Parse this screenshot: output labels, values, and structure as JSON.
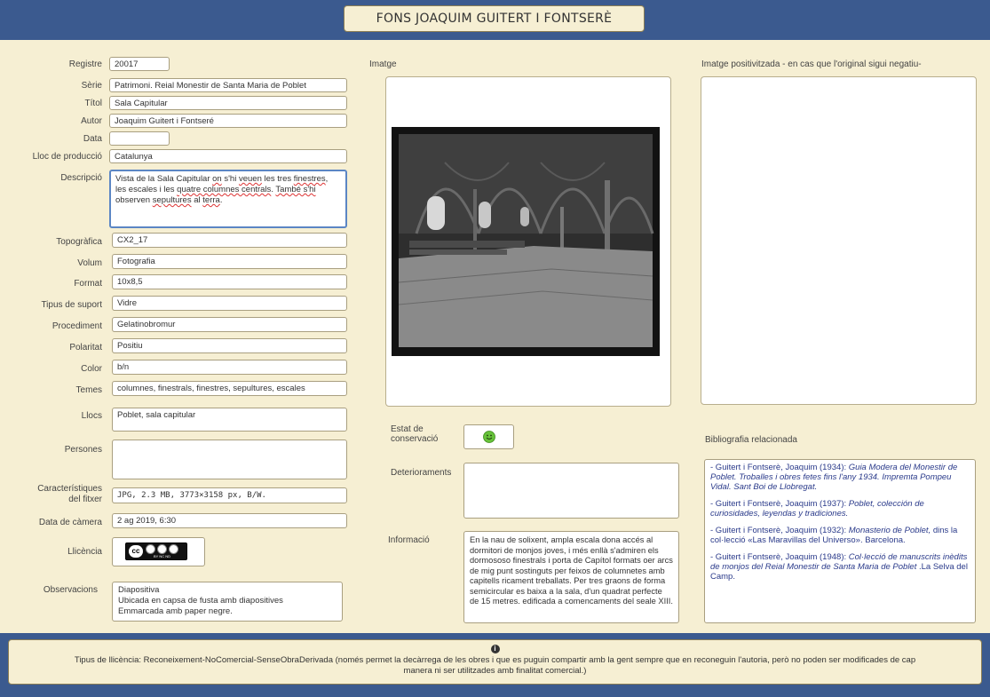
{
  "header": {
    "title": "FONS JOAQUIM GUITERT I FONTSERÈ"
  },
  "fields": {
    "registre": {
      "label": "Registre",
      "value": "20017"
    },
    "serie": {
      "label": "Sèrie",
      "value": "Patrimoni. Reial Monestir de Santa Maria de Poblet"
    },
    "titol": {
      "label": "Títol",
      "value": "Sala Capitular"
    },
    "autor": {
      "label": "Autor",
      "value": "Joaquim Guitert i Fontseré"
    },
    "data": {
      "label": "Data",
      "value": ""
    },
    "lloc": {
      "label": "Lloc de producció",
      "value": "Catalunya"
    },
    "descripcio": {
      "label": "Descripció",
      "parts": [
        "Vista de la Sala Capitular ",
        "on",
        " s'hi ",
        "veuen",
        " les tres ",
        "finestres",
        ", les escales i les ",
        "quatre columnes centrals",
        ". ",
        "També s'hi",
        " observen ",
        "sepultures",
        " al ",
        "terra",
        "."
      ]
    },
    "topografica": {
      "label": "Topogràfica",
      "value": "CX2_17"
    },
    "volum": {
      "label": "Volum",
      "value": "Fotografia"
    },
    "format": {
      "label": "Format",
      "value": "10x8,5"
    },
    "suport": {
      "label": "Tipus de suport",
      "value": "Vidre"
    },
    "procediment": {
      "label": "Procediment",
      "value": "Gelatinobromur"
    },
    "polaritat": {
      "label": "Polaritat",
      "value": "Positiu"
    },
    "color": {
      "label": "Color",
      "value": "b/n"
    },
    "temes": {
      "label": "Temes",
      "value": "columnes, finestrals, finestres, sepultures, escales"
    },
    "llocs": {
      "label": "Llocs",
      "value": "Poblet, sala capitular"
    },
    "persones": {
      "label": "Persones",
      "value": ""
    },
    "fitxer": {
      "label_line1": "Característiques",
      "label_line2": "del fitxer",
      "value": "JPG, 2.3 MB, 3773×3158 px, B/W."
    },
    "camera": {
      "label": "Data de càmera",
      "value": "2 ag 2019, 6:30"
    },
    "llicencia": {
      "label": "Llicència",
      "badge_text": "cc",
      "badge_sub": "BY NC ND"
    },
    "observacions": {
      "label": "Observacions",
      "lines": [
        "Diapositiva",
        "Ubicada en capsa de fusta amb diapositives",
        "Emmarcada amb paper negre."
      ]
    }
  },
  "image": {
    "label": "Imatge"
  },
  "image_positive": {
    "label": "Imatge positivitzada - en cas que l'original sigui negatiu-"
  },
  "estat": {
    "label_line1": "Estat de",
    "label_line2": "conservació",
    "icon": "smiley-face-icon"
  },
  "deterioraments": {
    "label": "Deterioraments",
    "value": ""
  },
  "informacio": {
    "label": "Informació",
    "value": "En la nau de solixent, ampla escala dona accés al dormitori de monjos joves, i més enllà s'admiren els dormososo finestrals i porta de Capítol formats oer arcs de mig punt sostinguts per feixos de columnetes amb capitells ricament treballats. Per tres graons de forma semicircular es baixa a la sala, d'un quadrat perfecte de 15 metres. edificada a comencaments del seale XIII."
  },
  "bibliografia": {
    "label": "Bibliografia relacionada",
    "entries": [
      {
        "prefix": "- Guitert i Fontserè, Joaquim (1934): ",
        "italic": "Guia Modera del Monestir de Poblet. Troballes i obres fetes fins l'any 1934. Impremta Pompeu Vidal. Sant Boi de Llobregat.",
        "suffix": ""
      },
      {
        "prefix": "- Guitert i Fontserè, Joaquim (1937): ",
        "italic": "Poblet, colección de curiosidades, leyendas y tradiciones.",
        "suffix": ""
      },
      {
        "prefix": "- Guitert i Fontserè, Joaquim (1932): ",
        "italic": "Monasterio de Poblet,",
        "suffix": " dins la col·lecció «Las Maravillas del Universo». Barcelona."
      },
      {
        "prefix": "- Guitert i Fontserè, Joaquim (1948): ",
        "italic": "Col·lecció de manuscrits inèdits de monjos del Reial Monestir de Santa Maria de Poblet",
        "suffix": " .La Selva del Camp."
      }
    ]
  },
  "footer": {
    "icon": "info-icon",
    "icon_glyph": "i",
    "line1": "Tipus de llicència: Reconeixement-NoComercial-SenseObraDerivada (només permet la decàrrega de les obres i que es puguin compartir amb la gent sempre que en reconeguin l'autoria, però no poden ser modificades de cap",
    "line2": "manera ni ser utilitzades amb finalitat comercial.)"
  },
  "colors": {
    "background": "#f6efd3",
    "bar": "#3b5a8f",
    "field_border": "#a99f80",
    "focus": "#5b86c4"
  }
}
